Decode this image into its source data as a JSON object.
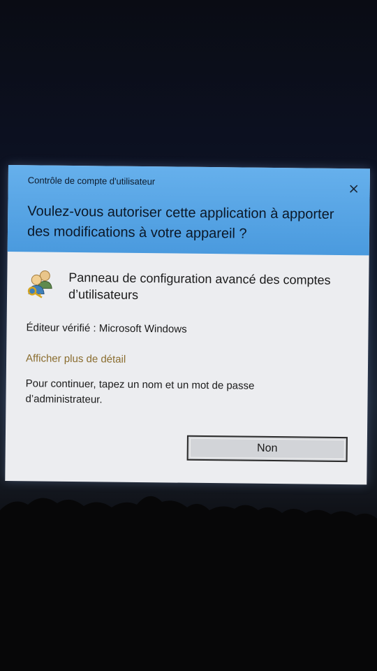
{
  "dialog": {
    "subtitle": "Contrôle de compte d'utilisateur",
    "title": "Voulez-vous autoriser cette application à apporter des modifications à votre appareil ?",
    "close_icon": "close-icon",
    "app_icon": "users-keys-icon",
    "app_name": "Panneau de configuration avancé des comptes d’utilisateurs",
    "publisher": "Éditeur vérifié : Microsoft Windows",
    "details_link": "Afficher plus de détail",
    "instructions": "Pour continuer, tapez un nom et un mot de passe d’administrateur.",
    "no_button": "Non"
  },
  "colors": {
    "header_blue": "#4a9ade",
    "body_background": "#ecedf0",
    "link_color": "#8a6d2f"
  }
}
